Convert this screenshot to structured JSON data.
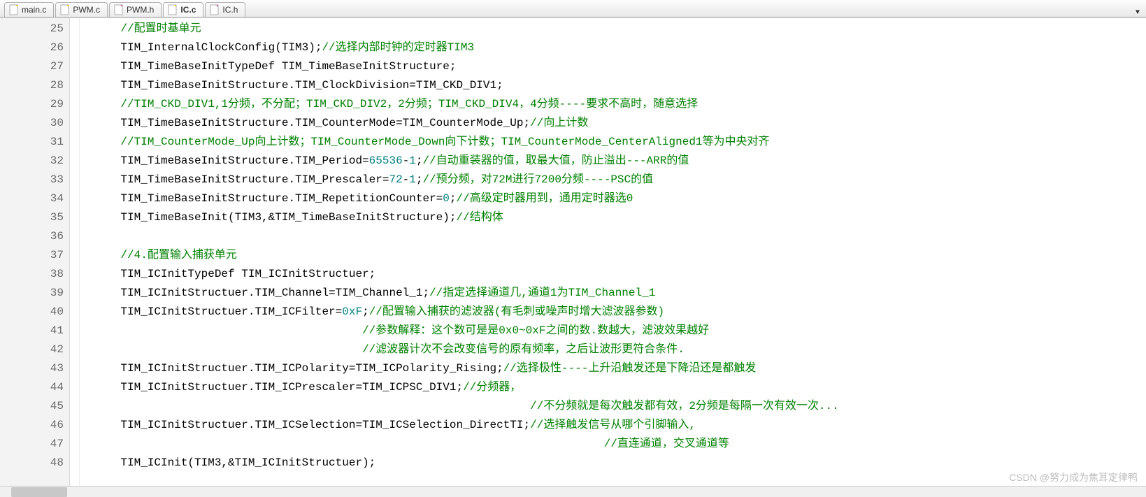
{
  "tabs": [
    {
      "label": "main.c",
      "active": false,
      "icon": "c"
    },
    {
      "label": "PWM.c",
      "active": false,
      "icon": "c"
    },
    {
      "label": "PWM.h",
      "active": false,
      "icon": "h"
    },
    {
      "label": "IC.c",
      "active": true,
      "icon": "c"
    },
    {
      "label": "IC.h",
      "active": false,
      "icon": "h"
    }
  ],
  "startLine": 25,
  "lines": {
    "25": {
      "indent": "    ",
      "segs": [
        {
          "t": "//配置时基单元",
          "c": "cmt"
        }
      ]
    },
    "26": {
      "indent": "    ",
      "segs": [
        {
          "t": "TIM_InternalClockConfig(TIM3);",
          "c": "txt"
        },
        {
          "t": "//选择内部时钟的定时器TIM3",
          "c": "cmt"
        }
      ]
    },
    "27": {
      "indent": "    ",
      "segs": [
        {
          "t": "TIM_TimeBaseInitTypeDef TIM_TimeBaseInitStructure;",
          "c": "txt"
        }
      ]
    },
    "28": {
      "indent": "    ",
      "segs": [
        {
          "t": "TIM_TimeBaseInitStructure.TIM_ClockDivision=TIM_CKD_DIV1;",
          "c": "txt"
        }
      ]
    },
    "29": {
      "indent": "    ",
      "segs": [
        {
          "t": "//TIM_CKD_DIV1,1分频，不分配；TIM_CKD_DIV2，2分频；TIM_CKD_DIV4，4分频----要求不高时，随意选择",
          "c": "cmt"
        }
      ]
    },
    "30": {
      "indent": "    ",
      "segs": [
        {
          "t": "TIM_TimeBaseInitStructure.TIM_CounterMode=TIM_CounterMode_Up;",
          "c": "txt"
        },
        {
          "t": "//向上计数",
          "c": "cmt"
        }
      ]
    },
    "31": {
      "indent": "    ",
      "segs": [
        {
          "t": "//TIM_CounterMode_Up向上计数；TIM_CounterMode_Down向下计数；TIM_CounterMode_CenterAligned1等为中央对齐",
          "c": "cmt"
        }
      ]
    },
    "32": {
      "indent": "    ",
      "segs": [
        {
          "t": "TIM_TimeBaseInitStructure.TIM_Period=",
          "c": "txt"
        },
        {
          "t": "65536",
          "c": "num"
        },
        {
          "t": "-",
          "c": "txt"
        },
        {
          "t": "1",
          "c": "num"
        },
        {
          "t": ";",
          "c": "txt"
        },
        {
          "t": "//自动重装器的值，取最大值，防止溢出---ARR的值",
          "c": "cmt"
        }
      ]
    },
    "33": {
      "indent": "    ",
      "segs": [
        {
          "t": "TIM_TimeBaseInitStructure.TIM_Prescaler=",
          "c": "txt"
        },
        {
          "t": "72",
          "c": "num"
        },
        {
          "t": "-",
          "c": "txt"
        },
        {
          "t": "1",
          "c": "num"
        },
        {
          "t": ";",
          "c": "txt"
        },
        {
          "t": "//预分频，对72M进行7200分频----PSC的值",
          "c": "cmt"
        }
      ]
    },
    "34": {
      "indent": "    ",
      "segs": [
        {
          "t": "TIM_TimeBaseInitStructure.TIM_RepetitionCounter=",
          "c": "txt"
        },
        {
          "t": "0",
          "c": "num"
        },
        {
          "t": ";",
          "c": "txt"
        },
        {
          "t": "//高级定时器用到，通用定时器选0",
          "c": "cmt"
        }
      ]
    },
    "35": {
      "indent": "    ",
      "segs": [
        {
          "t": "TIM_TimeBaseInit(TIM3,&TIM_TimeBaseInitStructure);",
          "c": "txt"
        },
        {
          "t": "//结构体",
          "c": "cmt"
        }
      ]
    },
    "36": {
      "indent": "    ",
      "segs": []
    },
    "37": {
      "indent": "    ",
      "segs": [
        {
          "t": "//4.配置输入捕获单元",
          "c": "cmt"
        }
      ]
    },
    "38": {
      "indent": "    ",
      "segs": [
        {
          "t": "TIM_ICInitTypeDef TIM_ICInitStructuer;",
          "c": "txt"
        }
      ]
    },
    "39": {
      "indent": "    ",
      "segs": [
        {
          "t": "TIM_ICInitStructuer.TIM_Channel=TIM_Channel_1;",
          "c": "txt"
        },
        {
          "t": "//指定选择通道几,通道1为TIM_Channel_1",
          "c": "cmt"
        }
      ]
    },
    "40": {
      "indent": "    ",
      "segs": [
        {
          "t": "TIM_ICInitStructuer.TIM_ICFilter=",
          "c": "txt"
        },
        {
          "t": "0xF",
          "c": "num"
        },
        {
          "t": ";",
          "c": "txt"
        },
        {
          "t": "//配置输入捕获的滤波器(有毛刺或噪声时增大滤波器参数)",
          "c": "cmt"
        }
      ]
    },
    "41": {
      "indent": "                                        ",
      "segs": [
        {
          "t": "//参数解释：这个数可是是0x0~0xF之间的数.数越大，滤波效果越好",
          "c": "cmt"
        }
      ]
    },
    "42": {
      "indent": "                                        ",
      "segs": [
        {
          "t": "//滤波器计次不会改变信号的原有频率，之后让波形更符合条件.",
          "c": "cmt"
        }
      ]
    },
    "43": {
      "indent": "    ",
      "segs": [
        {
          "t": "TIM_ICInitStructuer.TIM_ICPolarity=TIM_ICPolarity_Rising;",
          "c": "txt"
        },
        {
          "t": "//选择极性----上升沿触发还是下降沿还是都触发",
          "c": "cmt"
        }
      ]
    },
    "44": {
      "indent": "    ",
      "segs": [
        {
          "t": "TIM_ICInitStructuer.TIM_ICPrescaler=TIM_ICPSC_DIV1;",
          "c": "txt"
        },
        {
          "t": "//分频器，",
          "c": "cmt"
        }
      ]
    },
    "45": {
      "indent": "                                                                 ",
      "segs": [
        {
          "t": "//不分频就是每次触发都有效，2分频是每隔一次有效一次...",
          "c": "cmt"
        }
      ]
    },
    "46": {
      "indent": "    ",
      "segs": [
        {
          "t": "TIM_ICInitStructuer.TIM_ICSelection=TIM_ICSelection_DirectTI;",
          "c": "txt"
        },
        {
          "t": "//选择触发信号从哪个引脚输入,",
          "c": "cmt"
        }
      ]
    },
    "47": {
      "indent": "                                                                            ",
      "segs": [
        {
          "t": "//直连通道，交叉通道等",
          "c": "cmt"
        }
      ]
    },
    "48": {
      "indent": "    ",
      "segs": [
        {
          "t": "TIM_ICInit(TIM3,&TIM_ICInitStructuer);",
          "c": "txt"
        }
      ]
    }
  },
  "watermark": "CSDN @努力成为焦耳定律鸭"
}
